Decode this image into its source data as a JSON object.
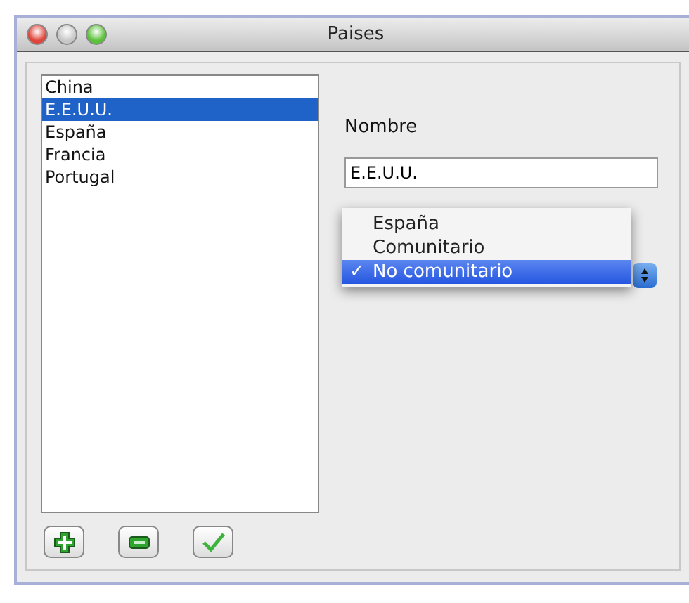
{
  "window": {
    "title": "Paises"
  },
  "countries": [
    {
      "label": "China",
      "selected": false
    },
    {
      "label": "E.E.U.U.",
      "selected": true
    },
    {
      "label": "España",
      "selected": false
    },
    {
      "label": "Francia",
      "selected": false
    },
    {
      "label": "Portugal",
      "selected": false
    }
  ],
  "form": {
    "name_label": "Nombre",
    "name_value": "E.E.U.U."
  },
  "popup": [
    {
      "label": "España",
      "selected": false
    },
    {
      "label": "Comunitario",
      "selected": false
    },
    {
      "label": "No comunitario",
      "selected": true
    }
  ],
  "popup_check": "✓",
  "buttons": [
    {
      "kind": "add"
    },
    {
      "kind": "remove"
    },
    {
      "kind": "accept"
    }
  ]
}
